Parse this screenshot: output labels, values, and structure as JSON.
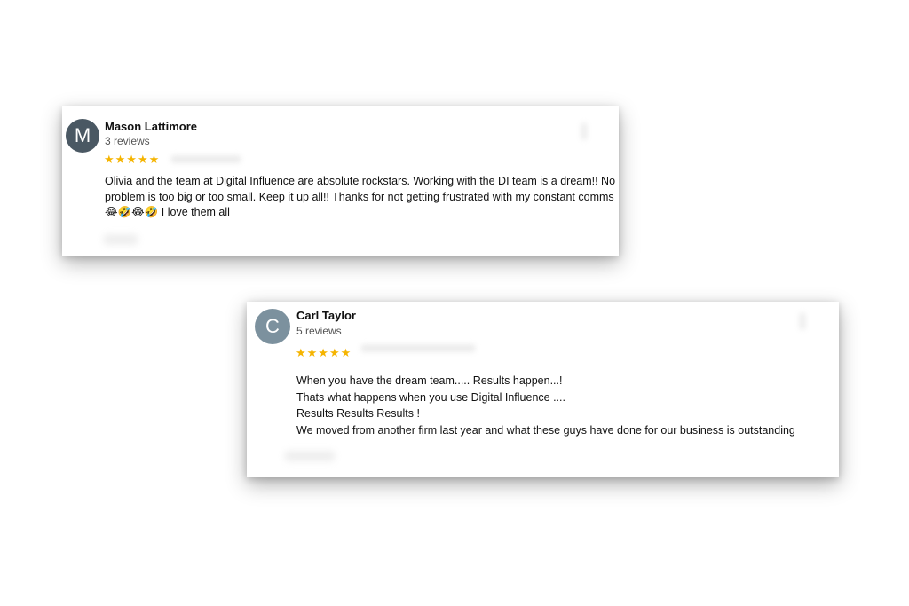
{
  "reviews": [
    {
      "avatar_letter": "M",
      "name": "Mason Lattimore",
      "review_count": "3 reviews",
      "stars": "★★★★★",
      "rating": 5,
      "lines": [
        "Olivia and the team at Digital Influence are absolute rockstars. Working with the DI team is a dream!! No",
        "problem is too big or too small. Keep it up all!! Thanks for not getting frustrated with my constant comms",
        "😂🤣😂🤣 I love them all"
      ]
    },
    {
      "avatar_letter": "C",
      "name": "Carl Taylor",
      "review_count": "5 reviews",
      "stars": "★★★★★",
      "rating": 5,
      "lines": [
        "When you have the dream team..... Results happen...!",
        "Thats what happens when you use Digital Influence ....",
        "Results Results Results !",
        "We moved from another firm last year and what these guys have done for our business is outstanding"
      ]
    }
  ],
  "colors": {
    "star": "#f5b400",
    "avatar_1": "#4a5863",
    "avatar_2": "#7c919e"
  }
}
